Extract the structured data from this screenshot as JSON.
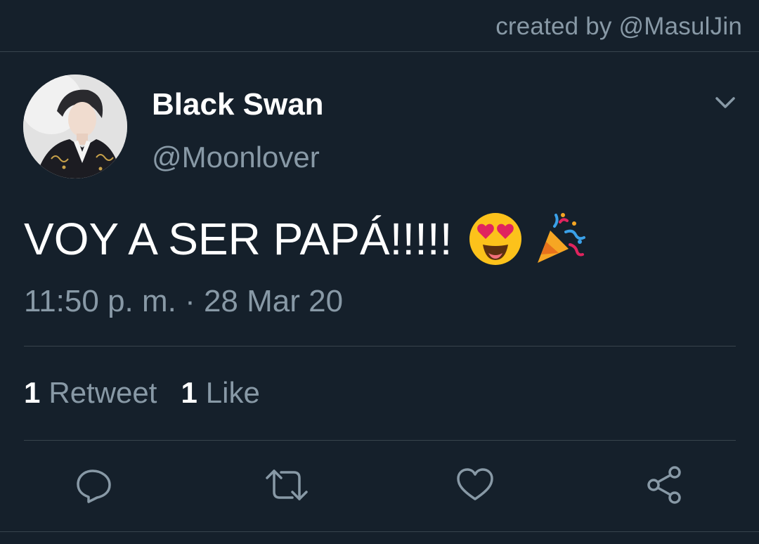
{
  "credit": "created by @MasulJin",
  "tweet": {
    "display_name": "Black Swan",
    "handle": "@Moonlover",
    "text": "VOY A SER PAPÁ!!!!!",
    "timestamp": "11:50 p. m. · 28 Mar 20"
  },
  "stats": {
    "retweets_count": "1",
    "retweets_label": "Retweet",
    "likes_count": "1",
    "likes_label": "Like"
  },
  "icons": {
    "caret": "chevron-down-icon",
    "emoji_1": "heart-eyes-emoji",
    "emoji_2": "party-popper-emoji",
    "reply": "reply-bubble-icon",
    "retweet": "retweet-icon",
    "like": "heart-icon",
    "share": "share-icon"
  },
  "colors": {
    "background": "#15202b",
    "divider": "#38444d",
    "secondary_text": "#8899a6",
    "primary_text": "#ffffff"
  }
}
